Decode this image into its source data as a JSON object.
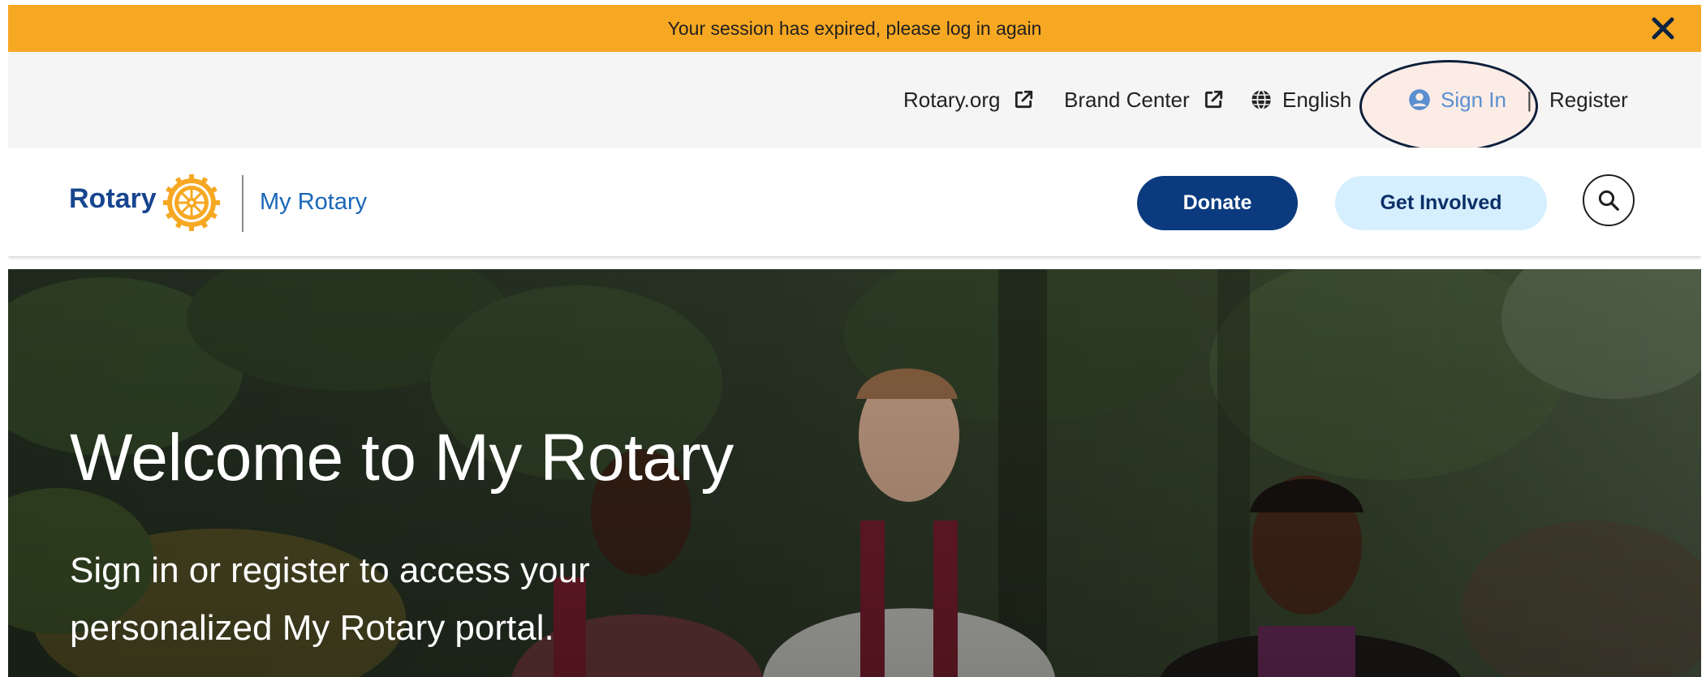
{
  "banner": {
    "message": "Your session has expired, please log in again",
    "close_icon": "close-icon",
    "color": "#f7a823"
  },
  "utility_nav": {
    "rotary_org": "Rotary.org",
    "brand_center": "Brand Center",
    "language": "English",
    "sign_in": "Sign In",
    "separator": "|",
    "register": "Register",
    "icons": [
      "external-link-icon",
      "globe-icon",
      "chevron-down-icon",
      "user-circle-icon"
    ]
  },
  "header": {
    "logo_text": "Rotary",
    "logo_sub": "My Rotary",
    "donate_label": "Donate",
    "get_involved_label": "Get Involved",
    "search_icon": "search-icon",
    "brand_colors": {
      "navy": "#0b3b7e",
      "gold": "#f7a823",
      "light_blue": "#d6efff",
      "link_blue": "#1a66b8"
    }
  },
  "hero": {
    "title": "Welcome to My Rotary",
    "subtitle": "Sign in or register to access your personalized My Rotary portal."
  }
}
